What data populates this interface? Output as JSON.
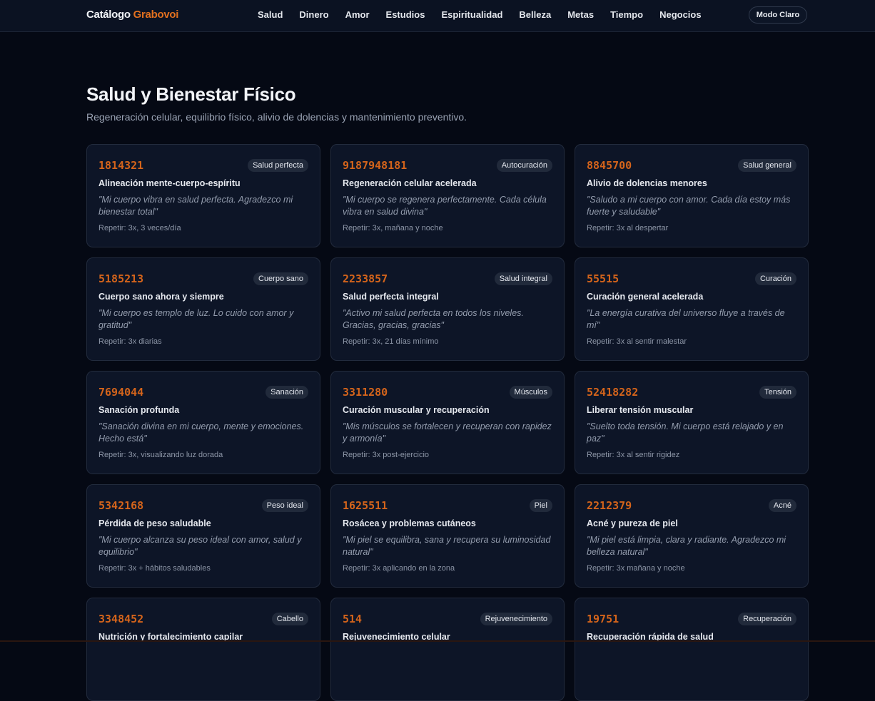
{
  "brand": {
    "part1": "Catálogo",
    "part2": "Grabovoi"
  },
  "nav": [
    "Salud",
    "Dinero",
    "Amor",
    "Estudios",
    "Espiritualidad",
    "Belleza",
    "Metas",
    "Tiempo",
    "Negocios"
  ],
  "mode_button": "Modo Claro",
  "page": {
    "title": "Salud y Bienestar Físico",
    "subtitle": "Regeneración celular, equilibrio físico, alivio de dolencias y mantenimiento preventivo."
  },
  "cards": [
    {
      "code": "1814321",
      "badge": "Salud perfecta",
      "title": "Alineación mente-cuerpo-espíritu",
      "quote": "\"Mi cuerpo vibra en salud perfecta. Agradezco mi bienestar total\"",
      "repeat": "Repetir: 3x, 3 veces/día"
    },
    {
      "code": "9187948181",
      "badge": "Autocuración",
      "title": "Regeneración celular acelerada",
      "quote": "\"Mi cuerpo se regenera perfectamente. Cada célula vibra en salud divina\"",
      "repeat": "Repetir: 3x, mañana y noche"
    },
    {
      "code": "8845700",
      "badge": "Salud general",
      "title": "Alivio de dolencias menores",
      "quote": "\"Saludo a mi cuerpo con amor. Cada día estoy más fuerte y saludable\"",
      "repeat": "Repetir: 3x al despertar"
    },
    {
      "code": "5185213",
      "badge": "Cuerpo sano",
      "title": "Cuerpo sano ahora y siempre",
      "quote": "\"Mi cuerpo es templo de luz. Lo cuido con amor y gratitud\"",
      "repeat": "Repetir: 3x diarias"
    },
    {
      "code": "2233857",
      "badge": "Salud integral",
      "title": "Salud perfecta integral",
      "quote": "\"Activo mi salud perfecta en todos los niveles. Gracias, gracias, gracias\"",
      "repeat": "Repetir: 3x, 21 días mínimo"
    },
    {
      "code": "55515",
      "badge": "Curación",
      "title": "Curación general acelerada",
      "quote": "\"La energía curativa del universo fluye a través de mí\"",
      "repeat": "Repetir: 3x al sentir malestar"
    },
    {
      "code": "7694044",
      "badge": "Sanación",
      "title": "Sanación profunda",
      "quote": "\"Sanación divina en mi cuerpo, mente y emociones. Hecho está\"",
      "repeat": "Repetir: 3x, visualizando luz dorada"
    },
    {
      "code": "3311280",
      "badge": "Músculos",
      "title": "Curación muscular y recuperación",
      "quote": "\"Mis músculos se fortalecen y recuperan con rapidez y armonía\"",
      "repeat": "Repetir: 3x post-ejercicio"
    },
    {
      "code": "52418282",
      "badge": "Tensión",
      "title": "Liberar tensión muscular",
      "quote": "\"Suelto toda tensión. Mi cuerpo está relajado y en paz\"",
      "repeat": "Repetir: 3x al sentir rigidez"
    },
    {
      "code": "5342168",
      "badge": "Peso ideal",
      "title": "Pérdida de peso saludable",
      "quote": "\"Mi cuerpo alcanza su peso ideal con amor, salud y equilibrio\"",
      "repeat": "Repetir: 3x + hábitos saludables"
    },
    {
      "code": "1625511",
      "badge": "Piel",
      "title": "Rosácea y problemas cutáneos",
      "quote": "\"Mi piel se equilibra, sana y recupera su luminosidad natural\"",
      "repeat": "Repetir: 3x aplicando en la zona"
    },
    {
      "code": "2212379",
      "badge": "Acné",
      "title": "Acné y pureza de piel",
      "quote": "\"Mi piel está limpia, clara y radiante. Agradezco mi belleza natural\"",
      "repeat": "Repetir: 3x mañana y noche"
    },
    {
      "code": "3348452",
      "badge": "Cabello",
      "title": "Nutrición y fortalecimiento capilar",
      "quote": "",
      "repeat": ""
    },
    {
      "code": "514",
      "badge": "Rejuvenecimiento",
      "title": "Rejuvenecimiento celular",
      "quote": "",
      "repeat": ""
    },
    {
      "code": "19751",
      "badge": "Recuperación",
      "title": "Recuperación rápida de salud",
      "quote": "",
      "repeat": ""
    }
  ]
}
